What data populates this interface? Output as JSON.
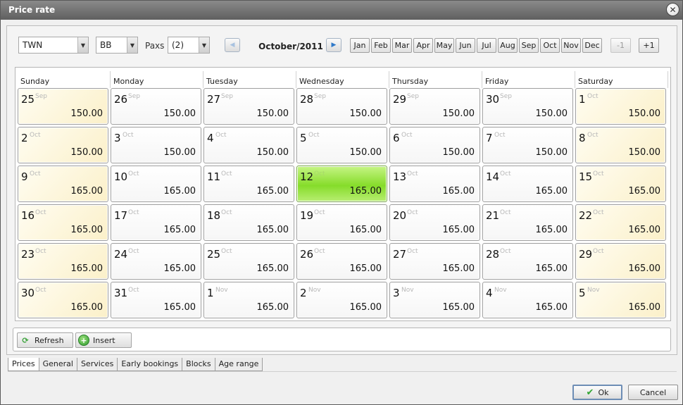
{
  "window": {
    "title": "Price rate",
    "close_icon": "close-icon"
  },
  "filters": {
    "room_type": "TWN",
    "board": "BB",
    "paxs_label": "Paxs",
    "paxs_value": "(2)"
  },
  "navigator": {
    "current_month": "October/2011",
    "months": [
      "Jan",
      "Feb",
      "Mar",
      "Apr",
      "May",
      "Jun",
      "Jul",
      "Aug",
      "Sep",
      "Oct",
      "Nov",
      "Dec"
    ],
    "year_minus": "-1",
    "year_plus": "+1"
  },
  "calendar": {
    "weekdays": [
      "Sunday",
      "Monday",
      "Tuesday",
      "Wednesday",
      "Thursday",
      "Friday",
      "Saturday"
    ],
    "today_index": 17,
    "cells": [
      {
        "day": "25",
        "mon": "Sep",
        "price": "150.00"
      },
      {
        "day": "26",
        "mon": "Sep",
        "price": "150.00"
      },
      {
        "day": "27",
        "mon": "Sep",
        "price": "150.00"
      },
      {
        "day": "28",
        "mon": "Sep",
        "price": "150.00"
      },
      {
        "day": "29",
        "mon": "Sep",
        "price": "150.00"
      },
      {
        "day": "30",
        "mon": "Sep",
        "price": "150.00"
      },
      {
        "day": "1",
        "mon": "Oct",
        "price": "150.00"
      },
      {
        "day": "2",
        "mon": "Oct",
        "price": "150.00"
      },
      {
        "day": "3",
        "mon": "Oct",
        "price": "150.00"
      },
      {
        "day": "4",
        "mon": "Oct",
        "price": "150.00"
      },
      {
        "day": "5",
        "mon": "Oct",
        "price": "150.00"
      },
      {
        "day": "6",
        "mon": "Oct",
        "price": "150.00"
      },
      {
        "day": "7",
        "mon": "Oct",
        "price": "150.00"
      },
      {
        "day": "8",
        "mon": "Oct",
        "price": "150.00"
      },
      {
        "day": "9",
        "mon": "Oct",
        "price": "165.00"
      },
      {
        "day": "10",
        "mon": "Oct",
        "price": "165.00"
      },
      {
        "day": "11",
        "mon": "Oct",
        "price": "165.00"
      },
      {
        "day": "12",
        "mon": "Oct",
        "price": "165.00"
      },
      {
        "day": "13",
        "mon": "Oct",
        "price": "165.00"
      },
      {
        "day": "14",
        "mon": "Oct",
        "price": "165.00"
      },
      {
        "day": "15",
        "mon": "Oct",
        "price": "165.00"
      },
      {
        "day": "16",
        "mon": "Oct",
        "price": "165.00"
      },
      {
        "day": "17",
        "mon": "Oct",
        "price": "165.00"
      },
      {
        "day": "18",
        "mon": "Oct",
        "price": "165.00"
      },
      {
        "day": "19",
        "mon": "Oct",
        "price": "165.00"
      },
      {
        "day": "20",
        "mon": "Oct",
        "price": "165.00"
      },
      {
        "day": "21",
        "mon": "Oct",
        "price": "165.00"
      },
      {
        "day": "22",
        "mon": "Oct",
        "price": "165.00"
      },
      {
        "day": "23",
        "mon": "Oct",
        "price": "165.00"
      },
      {
        "day": "24",
        "mon": "Oct",
        "price": "165.00"
      },
      {
        "day": "25",
        "mon": "Oct",
        "price": "165.00"
      },
      {
        "day": "26",
        "mon": "Oct",
        "price": "165.00"
      },
      {
        "day": "27",
        "mon": "Oct",
        "price": "165.00"
      },
      {
        "day": "28",
        "mon": "Oct",
        "price": "165.00"
      },
      {
        "day": "29",
        "mon": "Oct",
        "price": "165.00"
      },
      {
        "day": "30",
        "mon": "Oct",
        "price": "165.00"
      },
      {
        "day": "31",
        "mon": "Oct",
        "price": "165.00"
      },
      {
        "day": "1",
        "mon": "Nov",
        "price": "165.00"
      },
      {
        "day": "2",
        "mon": "Nov",
        "price": "165.00"
      },
      {
        "day": "3",
        "mon": "Nov",
        "price": "165.00"
      },
      {
        "day": "4",
        "mon": "Nov",
        "price": "165.00"
      },
      {
        "day": "5",
        "mon": "Nov",
        "price": "165.00"
      }
    ]
  },
  "actions": {
    "refresh": "Refresh",
    "insert": "Insert"
  },
  "tabs": [
    "Prices",
    "General",
    "Services",
    "Early bookings",
    "Blocks",
    "Age range"
  ],
  "dialog": {
    "ok": "Ok",
    "cancel": "Cancel"
  },
  "colors": {
    "today": "#86dc2a",
    "weekend": "#fbf0c9",
    "titlebar": "#6f6f6f"
  }
}
